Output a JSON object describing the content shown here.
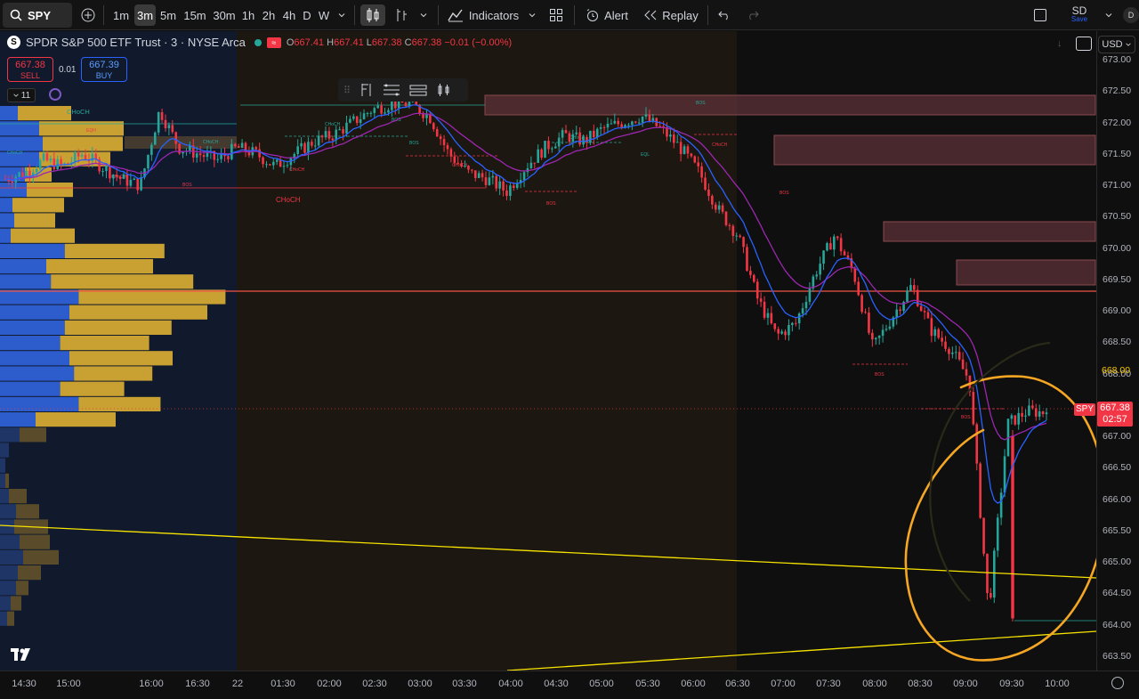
{
  "toolbar": {
    "symbol": "SPY",
    "intervals": [
      "1m",
      "3m",
      "5m",
      "15m",
      "30m",
      "1h",
      "2h",
      "4h",
      "D",
      "W"
    ],
    "active_interval": "3m",
    "indicators_label": "Indicators",
    "alert_label": "Alert",
    "replay_label": "Replay",
    "account_label": "SD",
    "save_label": "Save",
    "avatar_letter": "D"
  },
  "legend": {
    "title": "SPDR S&P 500 ETF Trust · 3 · NYSE Arca",
    "o_label": "O",
    "o_value": "667.41",
    "h_label": "H",
    "h_value": "667.41",
    "l_label": "L",
    "l_value": "667.38",
    "c_label": "C",
    "c_value": "667.38",
    "change": "−0.01 (−0.00%)"
  },
  "trade": {
    "sell_price": "667.38",
    "sell_label": "SELL",
    "buy_price": "667.39",
    "buy_label": "BUY",
    "spread": "0.01"
  },
  "indicator_count": "11",
  "currency": "USD",
  "price_scale": {
    "labels": [
      "673.00",
      "672.50",
      "672.00",
      "671.50",
      "671.00",
      "670.50",
      "670.00",
      "669.50",
      "669.00",
      "668.50",
      "668.00",
      "667.50",
      "667.00",
      "666.50",
      "666.00",
      "665.50",
      "665.00",
      "664.50",
      "664.00",
      "663.50"
    ],
    "highlight_price": "668.00",
    "current_price": "667.38",
    "countdown": "02:57",
    "symbol_tag": "SPY"
  },
  "time_scale": {
    "labels": [
      "14:30",
      "15:00",
      "16:00",
      "16:30",
      "22",
      "01:30",
      "02:00",
      "02:30",
      "03:00",
      "03:30",
      "04:00",
      "04:30",
      "05:00",
      "05:30",
      "06:00",
      "06:30",
      "07:00",
      "07:30",
      "08:00",
      "08:30",
      "09:00",
      "09:30",
      "10:00"
    ]
  },
  "annotations": {
    "choch": "CHoCH",
    "bos": "BOS",
    "eqh": "EQH",
    "eql": "EQL"
  },
  "colors": {
    "up": "#26a69a",
    "down": "#f23645",
    "ema_fast": "#2962ff",
    "ema_slow": "#9c27b0",
    "trendline": "#f7e300",
    "circle": "#f5a623",
    "vp_blue": "#2d5ccc",
    "vp_gold": "#c9a032"
  },
  "chart_data": {
    "type": "candlestick",
    "title": "SPDR S&P 500 ETF Trust · 3 · NYSE Arca",
    "ylim": [
      663.4,
      673.0
    ],
    "x_ticks": [
      "14:30",
      "15:00",
      "16:00",
      "16:30",
      "22",
      "01:30",
      "02:00",
      "02:30",
      "03:00",
      "03:30",
      "04:00",
      "04:30",
      "05:00",
      "05:30",
      "06:00",
      "06:30",
      "07:00",
      "07:30",
      "08:00",
      "08:30",
      "09:00",
      "09:30",
      "10:00"
    ],
    "close_path": [
      671.1,
      671.2,
      671.4,
      671.3,
      671.5,
      671.3,
      671.1,
      671.0,
      672.2,
      671.6,
      671.5,
      671.4,
      671.6,
      671.5,
      671.3,
      671.5,
      671.7,
      671.8,
      672.0,
      672.2,
      672.3,
      672.3,
      672.1,
      671.5,
      671.2,
      671.1,
      670.9,
      671.3,
      671.6,
      671.8,
      671.7,
      671.9,
      672.0,
      672.1,
      671.9,
      671.6,
      671.2,
      670.6,
      670.2,
      669.2,
      668.6,
      668.8,
      669.6,
      670.2,
      669.6,
      668.4,
      668.9,
      669.4,
      668.7,
      668.4,
      667.9,
      664.2,
      667.2,
      667.4,
      667.38
    ],
    "current_price": 667.38
  }
}
